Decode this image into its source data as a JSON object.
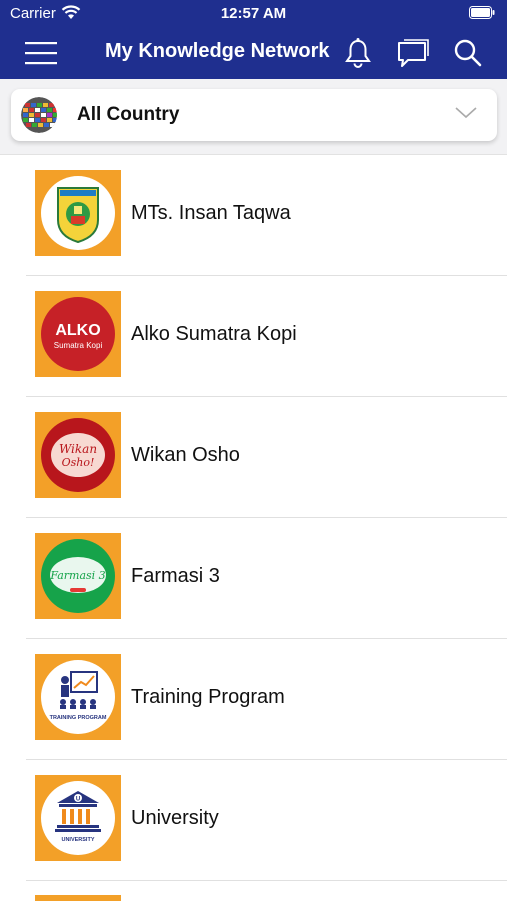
{
  "status_bar": {
    "carrier": "Carrier",
    "time": "12:57 AM"
  },
  "nav": {
    "title": "My Knowledge Network"
  },
  "country_selector": {
    "label": "All Country"
  },
  "items": [
    {
      "label": "MTs. Insan Taqwa",
      "logo_text": "MTs. INSAN TAQWA",
      "logo": "school-crest"
    },
    {
      "label": "Alko Sumatra Kopi",
      "logo_text": "ALKO",
      "logo_sub": "Sumatra Kopi",
      "logo": "alko-coffee"
    },
    {
      "label": "Wikan Osho",
      "logo_text": "Wikan",
      "logo_sub": "Osho!",
      "logo": "wikan-osho"
    },
    {
      "label": "Farmasi 3",
      "logo_text": "Farmasi 3",
      "logo": "farmasi"
    },
    {
      "label": "Training Program",
      "logo_text": "TRAINING PROGRAM",
      "logo": "training"
    },
    {
      "label": "University",
      "logo_text": "UNIVERSITY",
      "logo_letter": "U",
      "logo": "university"
    }
  ],
  "colors": {
    "header": "#1f2f8f",
    "thumb_bg": "#f3a028",
    "divider": "#e0e0e0"
  }
}
